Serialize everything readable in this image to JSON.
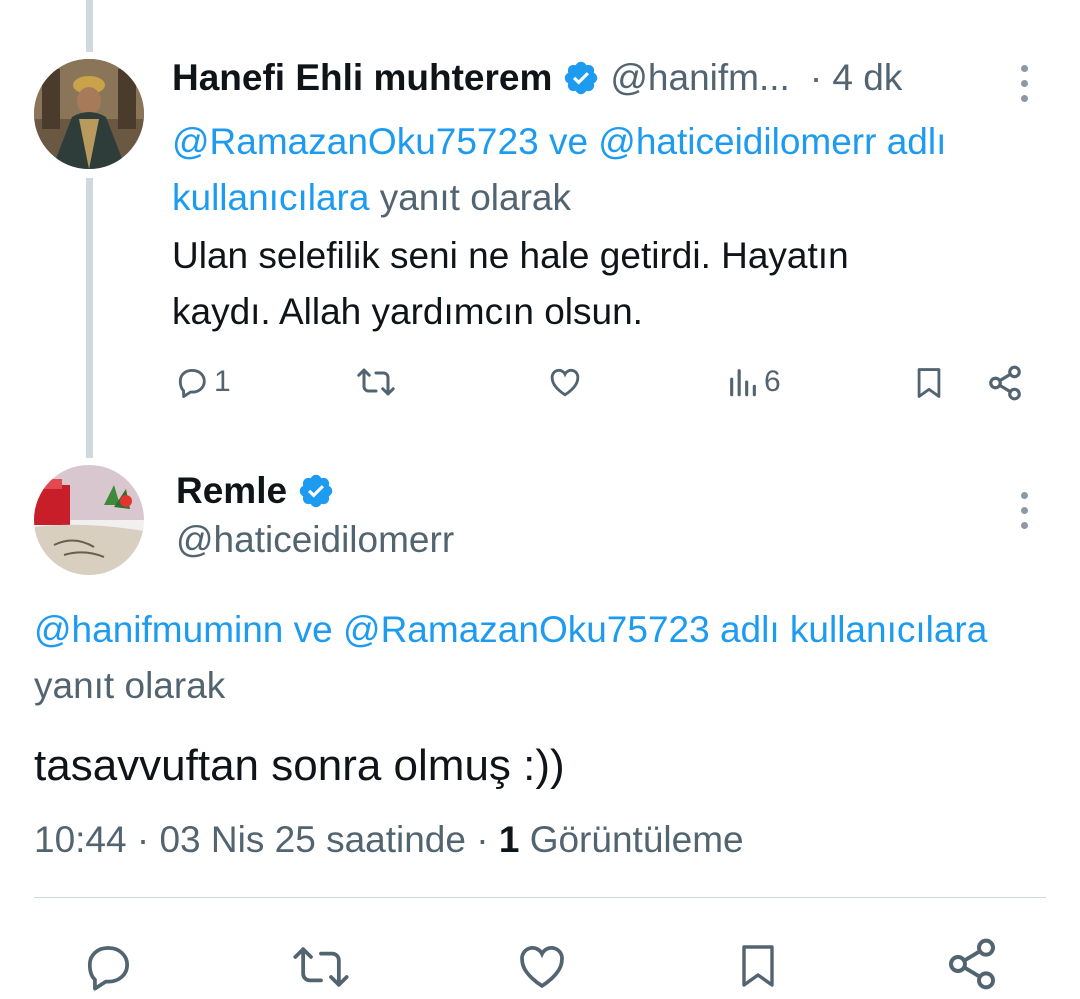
{
  "tweet1": {
    "display_name": "Hanefi Ehli muhterem",
    "handle": "@hanifm...",
    "time": "· 4 dk",
    "reply_users": "@RamazanOku75723 ve @haticeidilomerr adlı kullanıcılara",
    "reply_users_line1": "@RamazanOku75723 ve @haticeidilomerr adlı",
    "reply_users_line2": "kullanıcılara",
    "reply_suffix": "yanıt olarak",
    "text_line1": "Ulan selefilik seni ne hale getirdi. Hayatın",
    "text_line2": "kaydı. Allah yardımcın olsun.",
    "replies": "1",
    "views": "6",
    "icons": [
      "verified-badge-icon",
      "reply-icon",
      "retweet-icon",
      "like-icon",
      "views-icon",
      "bookmark-icon",
      "share-icon",
      "more-icon"
    ]
  },
  "tweet2": {
    "display_name": "Remle",
    "handle": "@haticeidilomerr",
    "reply_users": "@hanifmuminn ve @RamazanOku75723 adlı kullanıcılara",
    "reply_suffix": "yanıt olarak",
    "text": "tasavvuftan sonra olmuş :))",
    "time": "10:44",
    "date": "· 03 Nis 25 saatinde ·",
    "views_count": "1",
    "views_label": "Görüntüleme"
  },
  "colors": {
    "link": "#1d9bf0",
    "muted": "#536471",
    "text": "#0f1419",
    "thread_line": "#cfd9de"
  }
}
